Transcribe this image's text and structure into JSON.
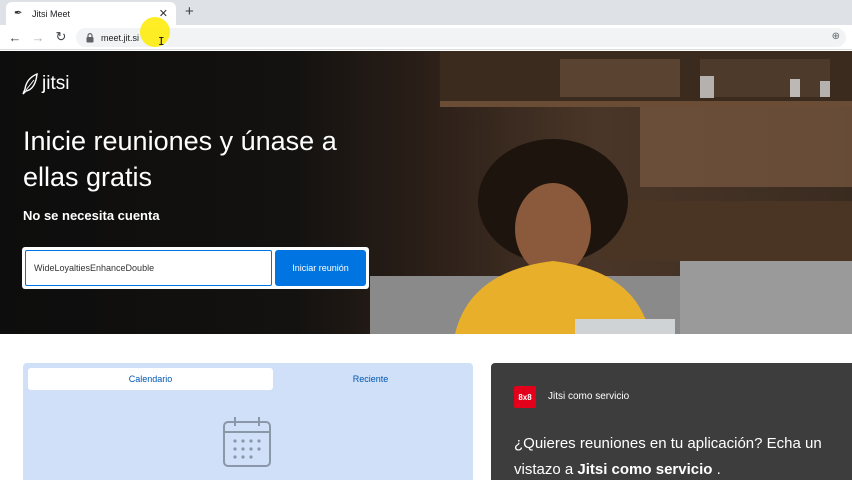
{
  "browser": {
    "tab_title": "Jitsi Meet",
    "url": "meet.jit.si"
  },
  "hero": {
    "logo_text": "jitsi",
    "title": "Inicie reuniones y únase a ellas gratis",
    "subtitle": "No se necesita cuenta",
    "room_name_value": "WideLoyaltiesEnhanceDouble",
    "start_button": "Iniciar reunión"
  },
  "meetings_panel": {
    "tabs": [
      {
        "label": "Calendario",
        "active": true
      },
      {
        "label": "Reciente",
        "active": false
      }
    ]
  },
  "service_card": {
    "badge": "8x8",
    "label": "Jitsi como servicio",
    "text_part1": "¿Quieres reuniones en tu aplicación? Echa un",
    "text_part2": "vistazo a ",
    "text_link": "Jitsi como servicio",
    "text_part3": " ."
  },
  "colors": {
    "accent": "#0074e0",
    "badge_red": "#e2001a",
    "panel_blue": "#cfe0f8",
    "card_dark": "#3d3d3d"
  }
}
